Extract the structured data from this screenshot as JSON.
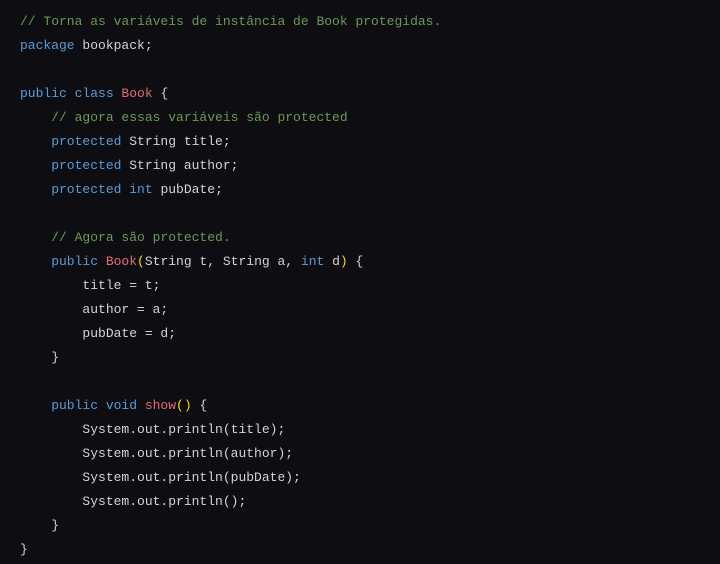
{
  "code": {
    "l1_comment": "// Torna as variáveis de instância de Book protegidas.",
    "l2_package": "package",
    "l2_name": " bookpack",
    "l2_semi": ";",
    "l4_public": "public",
    "l4_class": " class",
    "l4_book": " Book",
    "l4_brace": " {",
    "l5_comment": "    // agora essas variáveis são protected",
    "l6_protected": "    protected",
    "l6_type": " String",
    "l6_name": " title",
    "l6_semi": ";",
    "l7_protected": "    protected",
    "l7_type": " String",
    "l7_name": " author",
    "l7_semi": ";",
    "l8_protected": "    protected",
    "l8_type": " int",
    "l8_name": " pubDate",
    "l8_semi": ";",
    "l10_comment": "    // Agora são protected.",
    "l11_public": "    public",
    "l11_book": " Book",
    "l11_lparen": "(",
    "l11_p1t": "String",
    "l11_p1n": " t",
    "l11_c1": ", ",
    "l11_p2t": "String",
    "l11_p2n": " a",
    "l11_c2": ", ",
    "l11_p3t": "int",
    "l11_p3n": " d",
    "l11_rparen": ")",
    "l11_brace": " {",
    "l12": "        title = t;",
    "l13": "        author = a;",
    "l14": "        pubDate = d;",
    "l15": "    }",
    "l17_public": "    public",
    "l17_void": " void",
    "l17_show": " show",
    "l17_parens": "()",
    "l17_brace": " {",
    "l18_sys": "        System.out.println",
    "l18_arg": "(title);",
    "l19_sys": "        System.out.println",
    "l19_arg": "(author);",
    "l20_sys": "        System.out.println",
    "l20_arg": "(pubDate);",
    "l21_sys": "        System.out.println",
    "l21_arg": "();",
    "l22": "    }",
    "l23": "}"
  }
}
